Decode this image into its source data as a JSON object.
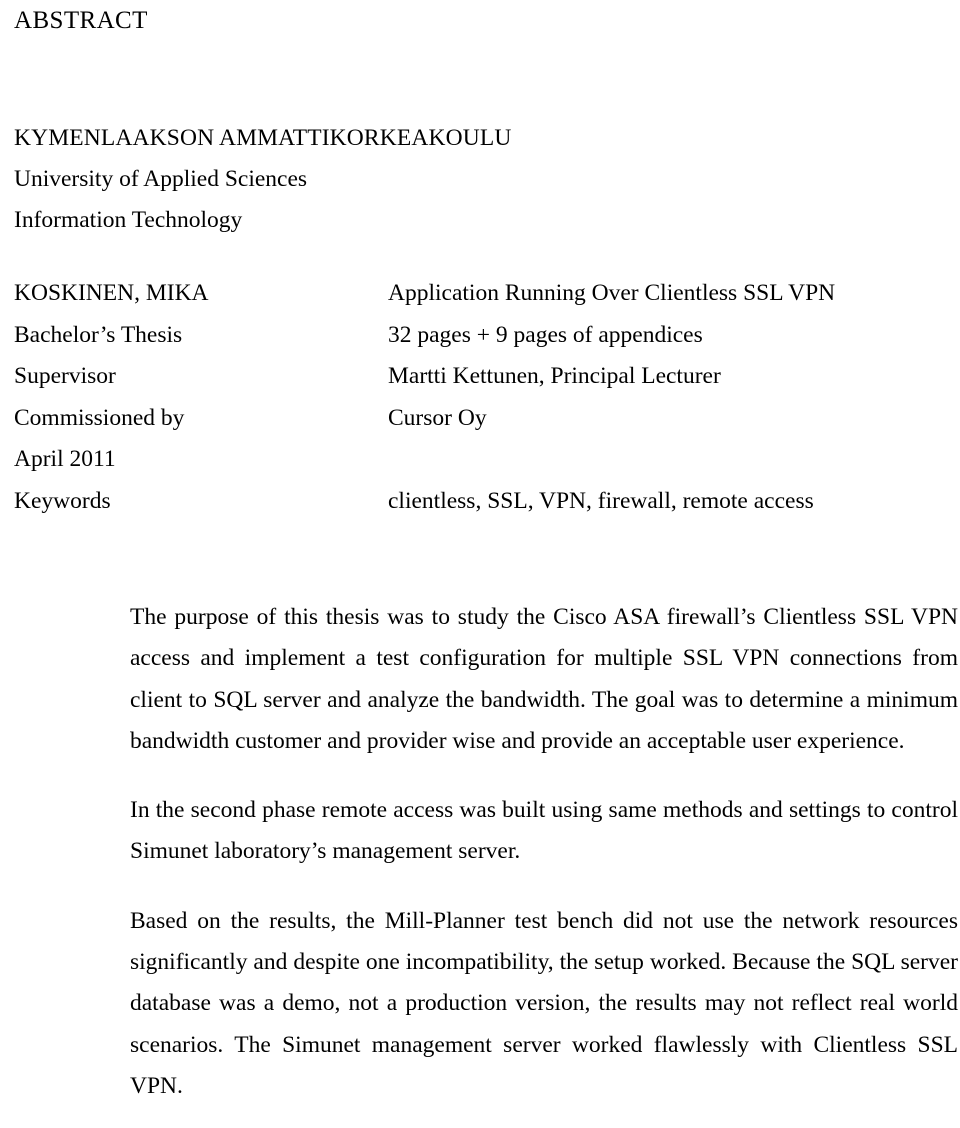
{
  "document": {
    "heading": "ABSTRACT"
  },
  "institution": {
    "lines": [
      "KYMENLAAKSON AMMATTIKORKEAKOULU",
      "University of Applied Sciences",
      "Information Technology"
    ]
  },
  "metadata": {
    "rows": [
      {
        "label": "KOSKINEN, MIKA",
        "value": "Application Running Over Clientless SSL VPN"
      },
      {
        "label": "Bachelor’s Thesis",
        "value": "32 pages + 9 pages of appendices"
      },
      {
        "label": "Supervisor",
        "value": "Martti Kettunen, Principal Lecturer"
      },
      {
        "label": "Commissioned by",
        "value": "Cursor Oy"
      },
      {
        "label": "April 2011",
        "value": ""
      },
      {
        "label": "Keywords",
        "value": "clientless, SSL, VPN, firewall, remote access"
      }
    ]
  },
  "abstract": {
    "paragraphs": [
      "The purpose of this thesis was to study the Cisco ASA firewall’s Clientless SSL VPN access and implement a test configuration for multiple SSL VPN connections from client to SQL server and analyze the bandwidth. The goal was to determine a minimum bandwidth customer and provider wise and provide an acceptable user experience.",
      "In the second phase remote access was built using same methods and settings to control Simunet laboratory’s management server.",
      "Based on the results, the Mill-Planner test bench did not use the network resources significantly and despite one incompatibility, the setup worked. Because the SQL server database was a demo, not a production version, the results may not reflect real world scenarios. The Simunet management server worked flawlessly with Clientless SSL VPN."
    ]
  },
  "style": {
    "text_color": "#000000",
    "page_background": "#ffffff"
  }
}
